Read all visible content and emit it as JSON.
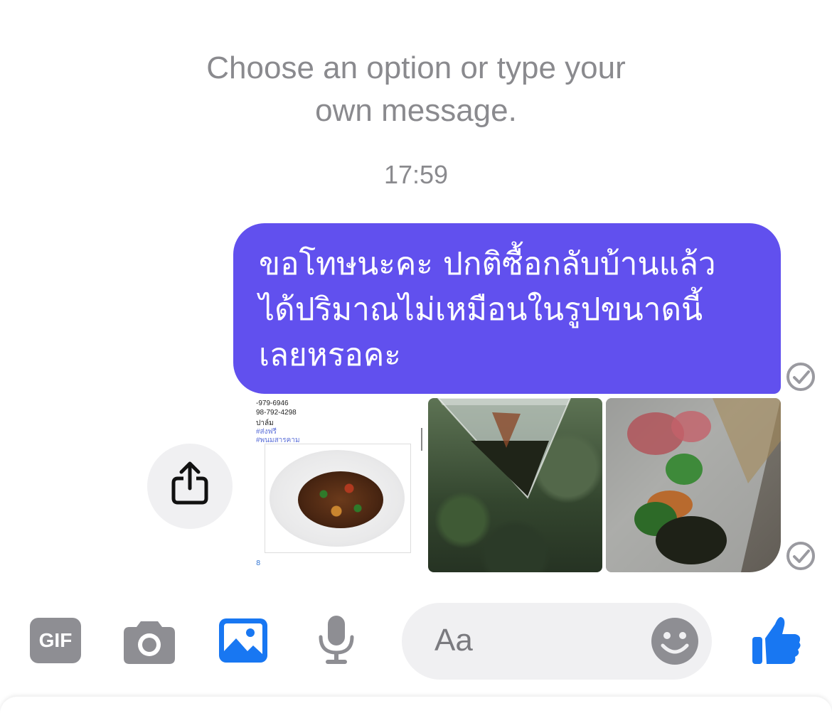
{
  "system_message": {
    "line1": "Choose an option or type your",
    "line2": "own message."
  },
  "timestamp": "17:59",
  "outgoing_message": {
    "line1": "ขอโทษนะคะ ปกติซื้อกลับบ้านแล้ว",
    "line2": "ได้ปริมาณไม่เหมือนในรูปขนาดนี้",
    "line3": "เลยหรอคะ",
    "bubble_color": "#6150ee"
  },
  "shared_screenshot": {
    "phone1": "-979-6946",
    "phone2": "98-792-4298",
    "label": "ปาล์ม",
    "tag1": "#ส่งฟรี",
    "tag2": "#พนมสารคาม",
    "footer": "8"
  },
  "icons": {
    "read_receipt": "check-circle-icon",
    "share": "share-icon",
    "gif": "gif-icon",
    "camera": "camera-icon",
    "gallery": "gallery-icon",
    "mic": "microphone-icon",
    "emoji": "emoji-icon",
    "like": "thumbs-up-icon"
  },
  "toolbar": {
    "gif_label": "GIF",
    "accent_color": "#1877f2"
  },
  "composer": {
    "placeholder": "Aa"
  }
}
